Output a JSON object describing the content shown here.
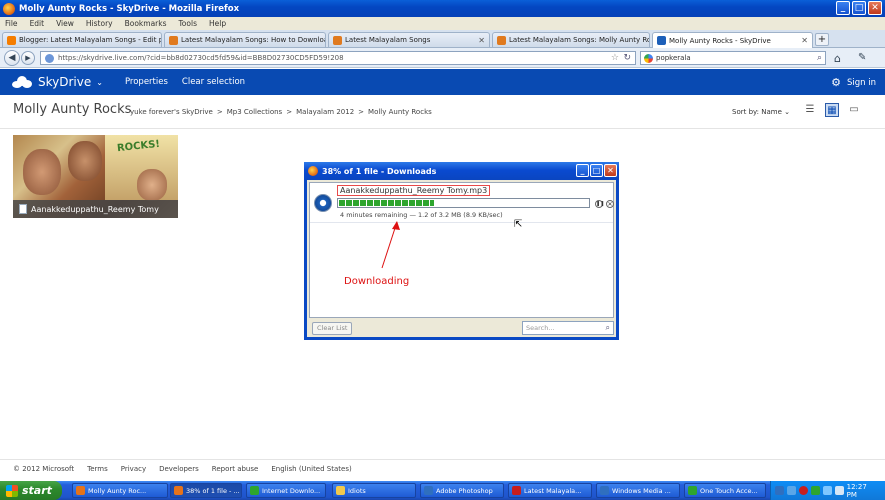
{
  "window": {
    "title": "Molly Aunty Rocks - SkyDrive - Mozilla Firefox",
    "controls": {
      "minimize": "_",
      "maximize": "□",
      "close": "✕"
    }
  },
  "menu": [
    "File",
    "Edit",
    "View",
    "History",
    "Bookmarks",
    "Tools",
    "Help"
  ],
  "tabs": [
    {
      "label": "Blogger: Latest Malayalam Songs - Edit p...",
      "icon_color": "#f57d00"
    },
    {
      "label": "Latest Malayalam Songs: How to Download ...",
      "icon_color": "#e07a1f"
    },
    {
      "label": "Latest Malayalam Songs",
      "icon_color": "#e07a1f"
    },
    {
      "label": "Latest Malayalam Songs: Molly Aunty Ro...",
      "icon_color": "#e07a1f"
    },
    {
      "label": "Molly Aunty Rocks - SkyDrive",
      "icon_color": "#1c5fb9"
    }
  ],
  "navbar": {
    "url": "https://skydrive.live.com/?cid=bb8d02730cd5fd59&id=BB8D02730CD5FD59!208",
    "url_host_bold": "live.com",
    "search_value": "popkerala"
  },
  "sky": {
    "brand": "SkyDrive",
    "properties": "Properties",
    "clear_selection": "Clear selection",
    "sign_in": "Sign in",
    "page_title": "Molly Aunty Rocks",
    "breadcrumb": [
      "yuke forever's SkyDrive",
      "Mp3 Collections",
      "Malayalam 2012",
      "Molly Aunty Rocks"
    ],
    "breadcrumb_sep": ">",
    "sort_by": "Sort by: Name",
    "brand_color": "#094ab2"
  },
  "file_tile": {
    "name": "Aanakkeduppathu_Reemy Tomy",
    "poster_text": "ROCKS!"
  },
  "downloads": {
    "title": "38% of 1 file - Downloads",
    "filename": "Aanakkeduppathu_Reemy Tomy.mp3",
    "progress": 0.38,
    "status": "4 minutes remaining — 1.2 of 3.2 MB (8.9 KB/sec)",
    "clear_list": "Clear List",
    "search_placeholder": "Search..."
  },
  "annotation": {
    "label": "Downloading",
    "color": "#d11"
  },
  "footer": [
    "© 2012 Microsoft",
    "Terms",
    "Privacy",
    "Developers",
    "Report abuse",
    "English (United States)"
  ],
  "taskbar": {
    "start": "start",
    "tasks": [
      {
        "label": "Molly Aunty Roc...",
        "icon_color": "#e6731a"
      },
      {
        "label": "38% of 1 file - ...",
        "icon_color": "#e6731a"
      },
      {
        "label": "Internet Downlo...",
        "icon_color": "#2ea52e"
      },
      {
        "label": "Idiots",
        "icon_color": "#f2c94c"
      },
      {
        "label": "Adobe Photoshop",
        "icon_color": "#2f6fbf"
      },
      {
        "label": "Latest Malayala...",
        "icon_color": "#c81e1e"
      },
      {
        "label": "Windows Media ...",
        "icon_color": "#2f6fbf"
      },
      {
        "label": "One Touch Acce...",
        "icon_color": "#2ea52e"
      }
    ],
    "clock": "12:27 PM"
  }
}
